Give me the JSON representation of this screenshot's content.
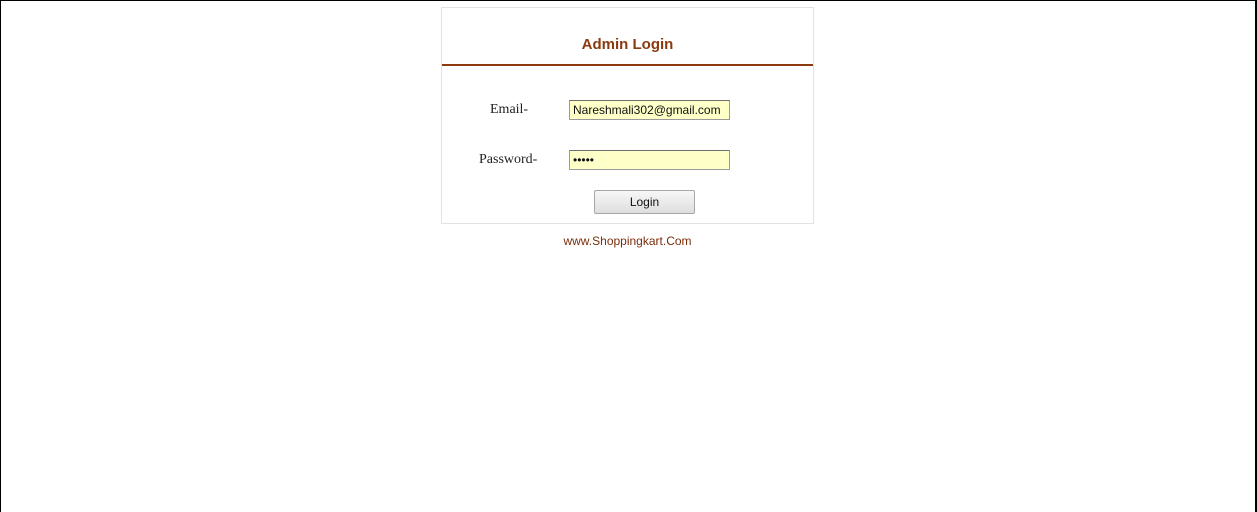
{
  "login": {
    "title": "Admin Login",
    "email_label": "Email-",
    "email_value": "Nareshmali302@gmail.com",
    "password_label": "Password-",
    "password_value": "*****",
    "button_label": "Login"
  },
  "footer": {
    "link_text": "www.Shoppingkart.Com"
  },
  "colors": {
    "accent": "#8b3a0e",
    "input_background": "#ffffc8",
    "footer_link": "#7a2e0c"
  }
}
